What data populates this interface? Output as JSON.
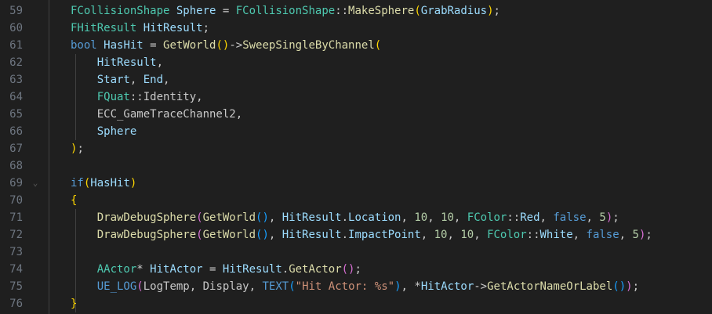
{
  "editor": {
    "lines": [
      {
        "number": "59",
        "fold": "",
        "tokens": [
          {
            "t": "FCollisionShape",
            "c": "ty"
          },
          {
            "t": " ",
            "c": "pn"
          },
          {
            "t": "Sphere",
            "c": "va"
          },
          {
            "t": " = ",
            "c": "pn"
          },
          {
            "t": "FCollisionShape",
            "c": "ty"
          },
          {
            "t": "::",
            "c": "pn"
          },
          {
            "t": "MakeSphere",
            "c": "fn"
          },
          {
            "t": "(",
            "c": "b1"
          },
          {
            "t": "GrabRadius",
            "c": "va"
          },
          {
            "t": ")",
            "c": "b1"
          },
          {
            "t": ";",
            "c": "pn"
          }
        ]
      },
      {
        "number": "60",
        "fold": "",
        "tokens": [
          {
            "t": "FHitResult",
            "c": "ty"
          },
          {
            "t": " ",
            "c": "pn"
          },
          {
            "t": "HitResult",
            "c": "va"
          },
          {
            "t": ";",
            "c": "pn"
          }
        ]
      },
      {
        "number": "61",
        "fold": "",
        "tokens": [
          {
            "t": "bool",
            "c": "kw"
          },
          {
            "t": " ",
            "c": "pn"
          },
          {
            "t": "HasHit",
            "c": "va"
          },
          {
            "t": " = ",
            "c": "pn"
          },
          {
            "t": "GetWorld",
            "c": "fn"
          },
          {
            "t": "()",
            "c": "b1"
          },
          {
            "t": "->",
            "c": "pn"
          },
          {
            "t": "SweepSingleByChannel",
            "c": "fn"
          },
          {
            "t": "(",
            "c": "b1"
          }
        ]
      },
      {
        "number": "62",
        "fold": "",
        "tokens": [
          {
            "t": "    ",
            "c": "pn"
          },
          {
            "t": "HitResult",
            "c": "va"
          },
          {
            "t": ",",
            "c": "pn"
          }
        ]
      },
      {
        "number": "63",
        "fold": "",
        "tokens": [
          {
            "t": "    ",
            "c": "pn"
          },
          {
            "t": "Start",
            "c": "va"
          },
          {
            "t": ", ",
            "c": "pn"
          },
          {
            "t": "End",
            "c": "va"
          },
          {
            "t": ",",
            "c": "pn"
          }
        ]
      },
      {
        "number": "64",
        "fold": "",
        "tokens": [
          {
            "t": "    ",
            "c": "pn"
          },
          {
            "t": "FQuat",
            "c": "ty"
          },
          {
            "t": "::",
            "c": "pn"
          },
          {
            "t": "Identity",
            "c": "ct"
          },
          {
            "t": ",",
            "c": "pn"
          }
        ]
      },
      {
        "number": "65",
        "fold": "",
        "tokens": [
          {
            "t": "    ",
            "c": "pn"
          },
          {
            "t": "ECC_GameTraceChannel2",
            "c": "ct"
          },
          {
            "t": ",",
            "c": "pn"
          }
        ]
      },
      {
        "number": "66",
        "fold": "",
        "tokens": [
          {
            "t": "    ",
            "c": "pn"
          },
          {
            "t": "Sphere",
            "c": "va"
          }
        ]
      },
      {
        "number": "67",
        "fold": "",
        "tokens": [
          {
            "t": ")",
            "c": "b1"
          },
          {
            "t": ";",
            "c": "pn"
          }
        ]
      },
      {
        "number": "68",
        "fold": "",
        "tokens": []
      },
      {
        "number": "69",
        "fold": "⌄",
        "tokens": [
          {
            "t": "if",
            "c": "kw"
          },
          {
            "t": "(",
            "c": "b1"
          },
          {
            "t": "HasHit",
            "c": "va"
          },
          {
            "t": ")",
            "c": "b1"
          }
        ]
      },
      {
        "number": "70",
        "fold": "",
        "tokens": [
          {
            "t": "{",
            "c": "b1"
          }
        ]
      },
      {
        "number": "71",
        "fold": "",
        "tokens": [
          {
            "t": "    ",
            "c": "pn"
          },
          {
            "t": "DrawDebugSphere",
            "c": "fn"
          },
          {
            "t": "(",
            "c": "b2"
          },
          {
            "t": "GetWorld",
            "c": "fn"
          },
          {
            "t": "()",
            "c": "b3"
          },
          {
            "t": ", ",
            "c": "pn"
          },
          {
            "t": "HitResult",
            "c": "va"
          },
          {
            "t": ".",
            "c": "pn"
          },
          {
            "t": "Location",
            "c": "va"
          },
          {
            "t": ", ",
            "c": "pn"
          },
          {
            "t": "10",
            "c": "nm"
          },
          {
            "t": ", ",
            "c": "pn"
          },
          {
            "t": "10",
            "c": "nm"
          },
          {
            "t": ", ",
            "c": "pn"
          },
          {
            "t": "FColor",
            "c": "ty"
          },
          {
            "t": "::",
            "c": "pn"
          },
          {
            "t": "Red",
            "c": "va"
          },
          {
            "t": ", ",
            "c": "pn"
          },
          {
            "t": "false",
            "c": "kw"
          },
          {
            "t": ", ",
            "c": "pn"
          },
          {
            "t": "5",
            "c": "nm"
          },
          {
            "t": ")",
            "c": "b2"
          },
          {
            "t": ";",
            "c": "pn"
          }
        ]
      },
      {
        "number": "72",
        "fold": "",
        "tokens": [
          {
            "t": "    ",
            "c": "pn"
          },
          {
            "t": "DrawDebugSphere",
            "c": "fn"
          },
          {
            "t": "(",
            "c": "b2"
          },
          {
            "t": "GetWorld",
            "c": "fn"
          },
          {
            "t": "()",
            "c": "b3"
          },
          {
            "t": ", ",
            "c": "pn"
          },
          {
            "t": "HitResult",
            "c": "va"
          },
          {
            "t": ".",
            "c": "pn"
          },
          {
            "t": "ImpactPoint",
            "c": "va"
          },
          {
            "t": ", ",
            "c": "pn"
          },
          {
            "t": "10",
            "c": "nm"
          },
          {
            "t": ", ",
            "c": "pn"
          },
          {
            "t": "10",
            "c": "nm"
          },
          {
            "t": ", ",
            "c": "pn"
          },
          {
            "t": "FColor",
            "c": "ty"
          },
          {
            "t": "::",
            "c": "pn"
          },
          {
            "t": "White",
            "c": "va"
          },
          {
            "t": ", ",
            "c": "pn"
          },
          {
            "t": "false",
            "c": "kw"
          },
          {
            "t": ", ",
            "c": "pn"
          },
          {
            "t": "5",
            "c": "nm"
          },
          {
            "t": ")",
            "c": "b2"
          },
          {
            "t": ";",
            "c": "pn"
          }
        ]
      },
      {
        "number": "73",
        "fold": "",
        "tokens": []
      },
      {
        "number": "74",
        "fold": "",
        "tokens": [
          {
            "t": "    ",
            "c": "pn"
          },
          {
            "t": "AActor",
            "c": "ty"
          },
          {
            "t": "* ",
            "c": "pn"
          },
          {
            "t": "HitActor",
            "c": "va"
          },
          {
            "t": " = ",
            "c": "pn"
          },
          {
            "t": "HitResult",
            "c": "va"
          },
          {
            "t": ".",
            "c": "pn"
          },
          {
            "t": "GetActor",
            "c": "fn"
          },
          {
            "t": "()",
            "c": "b2"
          },
          {
            "t": ";",
            "c": "pn"
          }
        ]
      },
      {
        "number": "75",
        "fold": "",
        "tokens": [
          {
            "t": "    ",
            "c": "pn"
          },
          {
            "t": "UE_LOG",
            "c": "mc"
          },
          {
            "t": "(",
            "c": "b2"
          },
          {
            "t": "LogTemp",
            "c": "ct"
          },
          {
            "t": ", ",
            "c": "pn"
          },
          {
            "t": "Display",
            "c": "ct"
          },
          {
            "t": ", ",
            "c": "pn"
          },
          {
            "t": "TEXT",
            "c": "mc"
          },
          {
            "t": "(",
            "c": "b3"
          },
          {
            "t": "\"Hit Actor: %s\"",
            "c": "st"
          },
          {
            "t": ")",
            "c": "b3"
          },
          {
            "t": ", ",
            "c": "pn"
          },
          {
            "t": "*",
            "c": "pn"
          },
          {
            "t": "HitActor",
            "c": "va"
          },
          {
            "t": "->",
            "c": "pn"
          },
          {
            "t": "GetActorNameOrLabel",
            "c": "fn"
          },
          {
            "t": "()",
            "c": "b3"
          },
          {
            "t": ")",
            "c": "b2"
          },
          {
            "t": ";",
            "c": "pn"
          }
        ]
      },
      {
        "number": "76",
        "fold": "",
        "tokens": [
          {
            "t": "}",
            "c": "b1"
          }
        ]
      }
    ]
  }
}
